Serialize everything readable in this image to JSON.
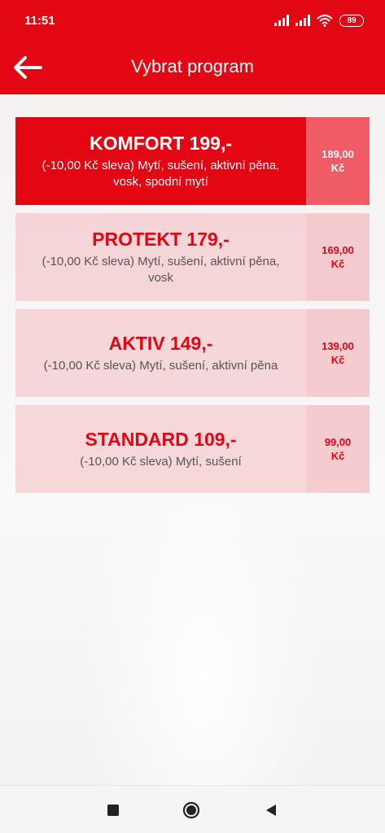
{
  "status_bar": {
    "time": "11:51",
    "battery": "89"
  },
  "header": {
    "title": "Vybrat program"
  },
  "programs": [
    {
      "name": "KOMFORT 199,-",
      "description": "(-10,00 Kč sleva) Mytí, sušení, aktivní pěna, vosk, spodní mytí",
      "price": "189,00",
      "currency": "Kč",
      "selected": true
    },
    {
      "name": "PROTEKT 179,-",
      "description": "(-10,00 Kč sleva) Mytí, sušení, aktivní pěna, vosk",
      "price": "169,00",
      "currency": "Kč",
      "selected": false
    },
    {
      "name": "AKTIV 149,-",
      "description": "(-10,00 Kč sleva) Mytí, sušení, aktivní pěna",
      "price": "139,00",
      "currency": "Kč",
      "selected": false
    },
    {
      "name": "STANDARD 109,-",
      "description": "(-10,00 Kč sleva) Mytí, sušení",
      "price": "99,00",
      "currency": "Kč",
      "selected": false
    }
  ],
  "colors": {
    "accent": "#e30613",
    "accent_light": "#ef5c66"
  },
  "nav_icons": [
    "recent-apps-icon",
    "home-icon",
    "back-triangle-icon"
  ]
}
